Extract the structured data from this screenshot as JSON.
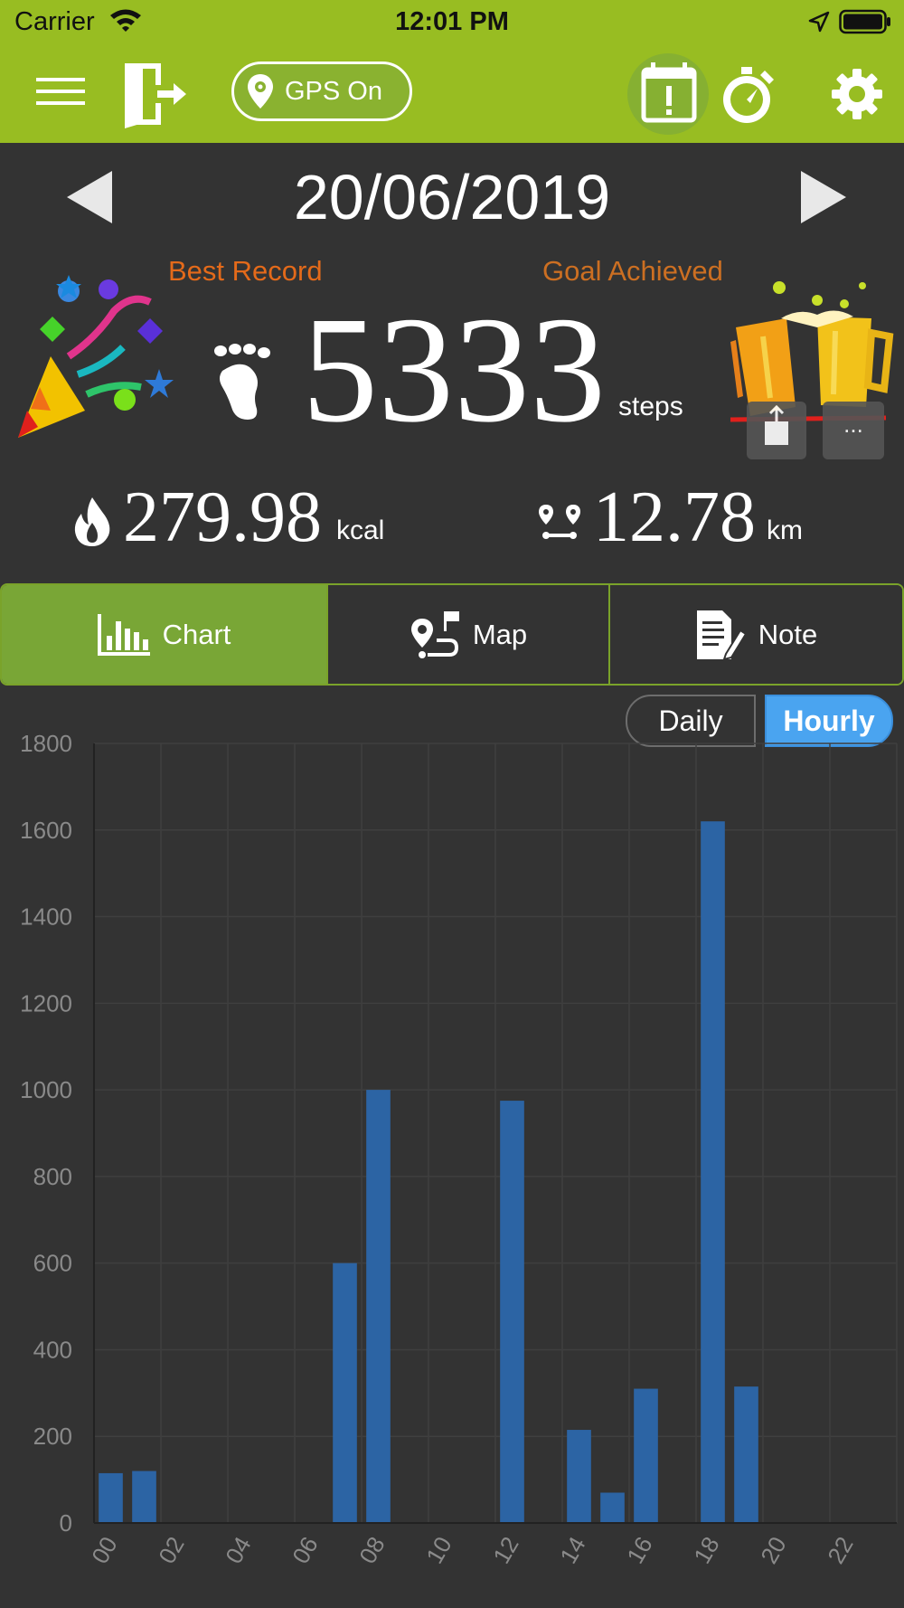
{
  "status_bar": {
    "carrier": "Carrier",
    "time": "12:01 PM"
  },
  "toolbar": {
    "gps_label": "GPS On"
  },
  "date": {
    "label": "20/06/2019"
  },
  "badges": {
    "best_record": "Best Record",
    "goal_achieved": "Goal Achieved"
  },
  "summary": {
    "steps": "5333",
    "steps_unit": "steps",
    "calories": "279.98",
    "calories_unit": "kcal",
    "distance": "12.78",
    "distance_unit": "km",
    "more_label": "..."
  },
  "tabs": [
    {
      "label": "Chart",
      "active": true
    },
    {
      "label": "Map",
      "active": false
    },
    {
      "label": "Note",
      "active": false
    }
  ],
  "view_toggle": {
    "daily": "Daily",
    "hourly": "Hourly",
    "selected": "Hourly"
  },
  "colors": {
    "accent": "#98bd22",
    "tab_active": "#79a636",
    "bar": "#2c64a4",
    "toggle_selected": "#4aa4f0",
    "background": "#333333"
  },
  "icons": {
    "menu": "menu-icon",
    "logout": "logout-icon",
    "gps": "location-pin-icon",
    "calendar": "calendar-alert-icon",
    "stopwatch": "stopwatch-icon",
    "settings": "gear-icon",
    "steps": "footprint-icon",
    "calories": "flame-icon",
    "distance": "route-icon"
  },
  "chart_data": {
    "type": "bar",
    "x": [
      0,
      1,
      2,
      3,
      4,
      5,
      6,
      7,
      8,
      9,
      10,
      11,
      12,
      13,
      14,
      15,
      16,
      17,
      18,
      19,
      20,
      21,
      22,
      23
    ],
    "values": [
      115,
      120,
      0,
      0,
      0,
      0,
      0,
      600,
      1000,
      0,
      0,
      0,
      975,
      0,
      215,
      70,
      310,
      0,
      1620,
      315,
      0,
      0,
      0,
      0
    ],
    "xtick_labels": [
      "00",
      "02",
      "04",
      "06",
      "08",
      "10",
      "12",
      "14",
      "16",
      "18",
      "20",
      "22"
    ],
    "yticks": [
      0,
      200,
      400,
      600,
      800,
      1000,
      1200,
      1400,
      1600,
      1800
    ],
    "ylim": [
      0,
      1800
    ],
    "grid": true,
    "xlabel": "",
    "ylabel": ""
  }
}
